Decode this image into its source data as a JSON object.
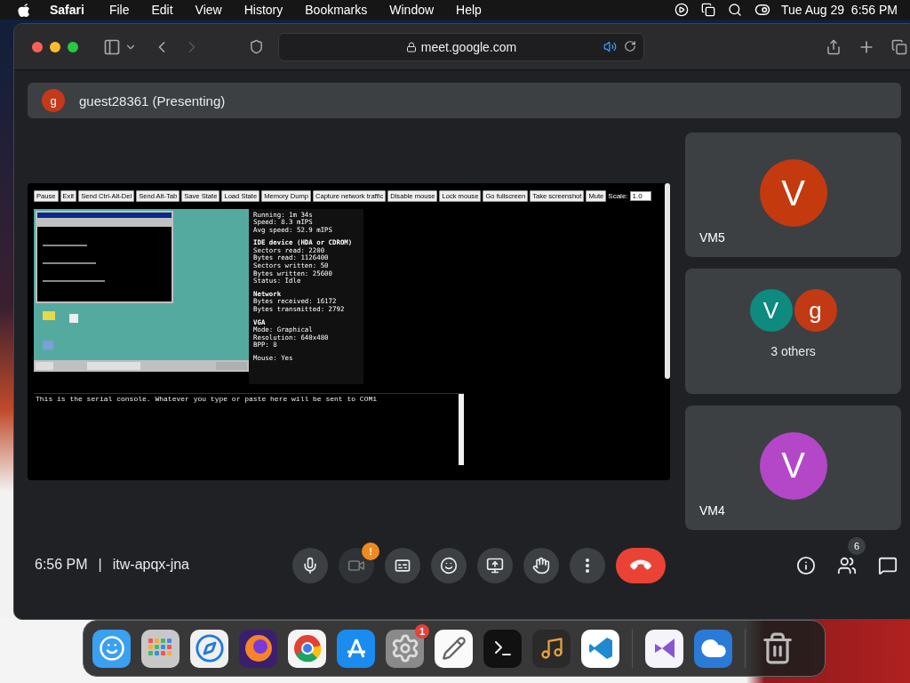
{
  "menubar": {
    "app": "Safari",
    "menus": [
      "File",
      "Edit",
      "View",
      "History",
      "Bookmarks",
      "Window",
      "Help"
    ],
    "clock": "Tue Aug 29  6:56 PM"
  },
  "browser": {
    "url": "meet.google.com",
    "audio_playing": true
  },
  "presenter": {
    "avatar": "g",
    "color": "#c5381a",
    "name": "guest28361 (Presenting)"
  },
  "emulator": {
    "buttons": [
      "Pause",
      "Exit",
      "Send Ctrl-Alt-Del",
      "Send Alt-Tab",
      "Save State",
      "Load State",
      "Memory Dump",
      "Capture network traffic",
      "Disable mouse",
      "Lock mouse",
      "Go fullscreen",
      "Take screenshot",
      "Mute"
    ],
    "scale_label": "Scale:",
    "scale_value": "1.0",
    "stats": [
      {
        "lines": [
          "Running: 1m 34s",
          "Speed: 8.3 mIPS",
          "Avg speed: 52.9 mIPS"
        ]
      },
      {
        "heading": "IDE device (HDA or CDROM)",
        "lines": [
          "Sectors read: 2200",
          "Bytes read: 1126400",
          "Sectors written: 50",
          "Bytes written: 25600",
          "Status: Idle"
        ]
      },
      {
        "heading": "Network",
        "lines": [
          "Bytes received: 16172",
          "Bytes transmitted: 2792"
        ]
      },
      {
        "heading": "VGA",
        "lines": [
          "Mode: Graphical",
          "Resolution: 640x480",
          "BPP: 8"
        ]
      },
      {
        "lines": [
          "Mouse: Yes"
        ]
      }
    ],
    "serial_console": "This is the serial console. Whatever you type or paste here will be sent to COM1"
  },
  "tiles": [
    {
      "kind": "single",
      "avatars": [
        {
          "letter": "V",
          "color": "#c5390e"
        }
      ],
      "label": "VM5"
    },
    {
      "kind": "group",
      "avatars": [
        {
          "letter": "V",
          "color": "#0e8a7f"
        },
        {
          "letter": "g",
          "color": "#c23a14"
        }
      ],
      "label": "3 others"
    },
    {
      "kind": "single",
      "avatars": [
        {
          "letter": "V",
          "color": "#b447c8"
        }
      ],
      "label": "VM4"
    }
  ],
  "call_bar": {
    "time": "6:56 PM",
    "separator": "|",
    "meeting_code": "itw-apqx-jna",
    "controls": [
      {
        "kind": "mic",
        "alert": false
      },
      {
        "kind": "camera",
        "alert": true,
        "badge": "!"
      },
      {
        "kind": "captions",
        "alert": false
      },
      {
        "kind": "emoji",
        "alert": false
      },
      {
        "kind": "present",
        "alert": false
      },
      {
        "kind": "hand",
        "alert": false
      },
      {
        "kind": "more",
        "alert": false
      },
      {
        "kind": "hangup",
        "alert": false
      }
    ],
    "people_count": "6"
  },
  "dock": [
    {
      "kind": "finder"
    },
    {
      "kind": "launchpad"
    },
    {
      "kind": "safari"
    },
    {
      "kind": "firefox"
    },
    {
      "kind": "chrome"
    },
    {
      "kind": "appstore"
    },
    {
      "kind": "settings",
      "badge": "1"
    },
    {
      "kind": "textedit"
    },
    {
      "kind": "terminal"
    },
    {
      "kind": "garageband"
    },
    {
      "kind": "vscode"
    },
    {
      "kind": "separator"
    },
    {
      "kind": "vs"
    },
    {
      "kind": "weather"
    },
    {
      "kind": "separator"
    },
    {
      "kind": "trash"
    }
  ]
}
